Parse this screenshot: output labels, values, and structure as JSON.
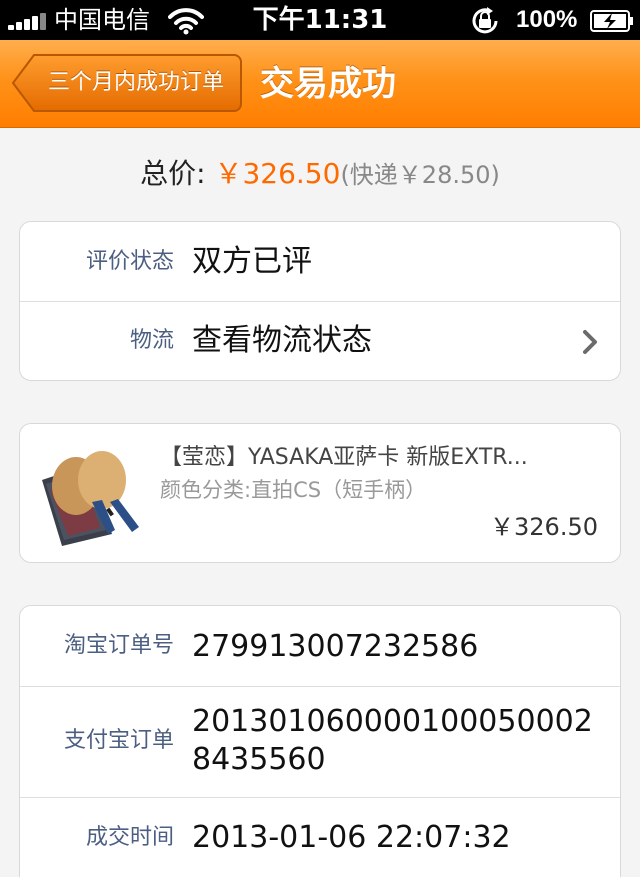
{
  "status_bar": {
    "carrier": "中国电信",
    "time": "下午11:31",
    "battery": "100%"
  },
  "nav": {
    "back_label": "三个月内成功订单",
    "title": "交易成功"
  },
  "total": {
    "label": "总价:",
    "amount": "￥326.50",
    "shipping": "(快递￥28.50)"
  },
  "status_card": {
    "rows": [
      {
        "label": "评价状态",
        "value": "双方已评"
      },
      {
        "label": "物流",
        "value": "查看物流状态"
      }
    ]
  },
  "item": {
    "title": "【莹恋】YASAKA亚萨卡 新版EXTR...",
    "spec": "颜色分类:直拍CS（短手柄）",
    "price": "￥326.50",
    "thumbnail_icon": "table-tennis-paddle-icon"
  },
  "order_info": {
    "rows": [
      {
        "label": "淘宝订单号",
        "value": "279913007232586"
      },
      {
        "label": "支付宝订单",
        "value_line1": "201301060000100050002",
        "value_line2": "8435560"
      },
      {
        "label": "成交时间",
        "value": "2013-01-06 22:07:32"
      }
    ]
  },
  "colors": {
    "accent": "#ff7e00",
    "price": "#ff6a00",
    "label": "#4c5f82"
  }
}
